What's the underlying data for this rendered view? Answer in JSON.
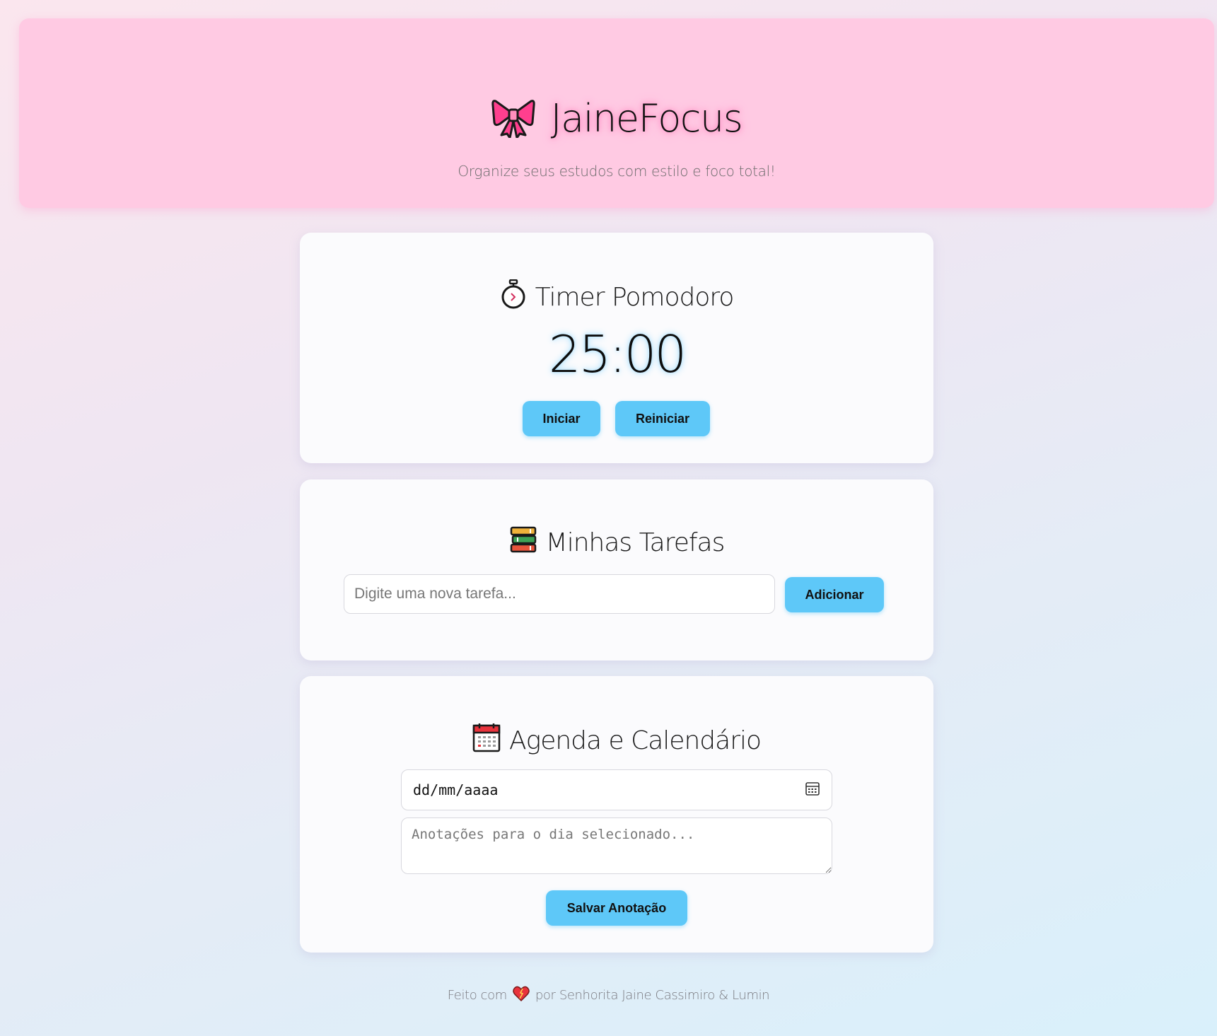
{
  "header": {
    "title": "JaineFocus",
    "subtitle": "Organize seus estudos com estilo e foco total!",
    "icon": "ribbon-bow-icon"
  },
  "pomodoro": {
    "title": "Timer Pomodoro",
    "icon": "stopwatch-icon",
    "time": "25:00",
    "start_label": "Iniciar",
    "reset_label": "Reiniciar"
  },
  "tasks": {
    "title": "Minhas Tarefas",
    "icon": "books-icon",
    "input_placeholder": "Digite uma nova tarefa...",
    "input_value": "",
    "add_label": "Adicionar"
  },
  "agenda": {
    "title": "Agenda e Calendário",
    "icon": "calendar-icon",
    "date_value": "dd/mm/aaaa",
    "notes_placeholder": "Anotações para o dia selecionado...",
    "save_label": "Salvar Anotação"
  },
  "footer": {
    "prefix": "Feito com",
    "suffix": "por Senhorita Jaine Cassimiro & Lumin",
    "icon": "heart-icon"
  },
  "colors": {
    "header_bg": "#ffcae3",
    "button_bg": "#5ec8f8",
    "card_bg": "#fbfbfd"
  }
}
